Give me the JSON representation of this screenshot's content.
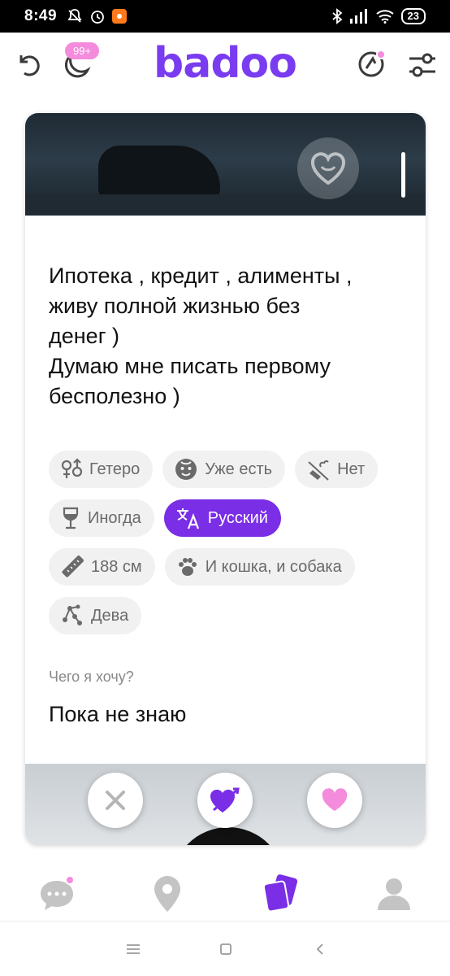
{
  "status_bar": {
    "time": "8:49",
    "battery": "23",
    "icons": [
      "mute-icon",
      "alarm-icon",
      "app-icon",
      "bluetooth-icon",
      "signal-icon",
      "wifi-icon",
      "battery-icon"
    ]
  },
  "header": {
    "logo": "badoo",
    "badge": "99+",
    "accent_color": "#7a3cf0",
    "badge_color": "#f48bdc"
  },
  "profile": {
    "about": "Ипотека , кредит , алименты ,\nживу полной жизнью без\nденег )\nДумаю мне писать первому\nбесполезно )",
    "chips": [
      {
        "icon": "gender-icon",
        "label": "Гетеро"
      },
      {
        "icon": "child-icon",
        "label": "Уже есть"
      },
      {
        "icon": "smoking-icon",
        "label": "Нет"
      },
      {
        "icon": "wine-icon",
        "label": "Иногда"
      },
      {
        "icon": "translate-icon",
        "label": "Русский",
        "active": true
      },
      {
        "icon": "ruler-icon",
        "label": "188 см"
      },
      {
        "icon": "paw-icon",
        "label": "И кошка, и собака"
      },
      {
        "icon": "constellation-icon",
        "label": "Дева"
      }
    ],
    "want_label": "Чего я хочу?",
    "want_value": "Пока не знаю"
  },
  "actions": [
    "dislike-button",
    "crush-button",
    "like-button"
  ],
  "bottom_nav": [
    "chats",
    "people-nearby",
    "encounters",
    "profile"
  ]
}
